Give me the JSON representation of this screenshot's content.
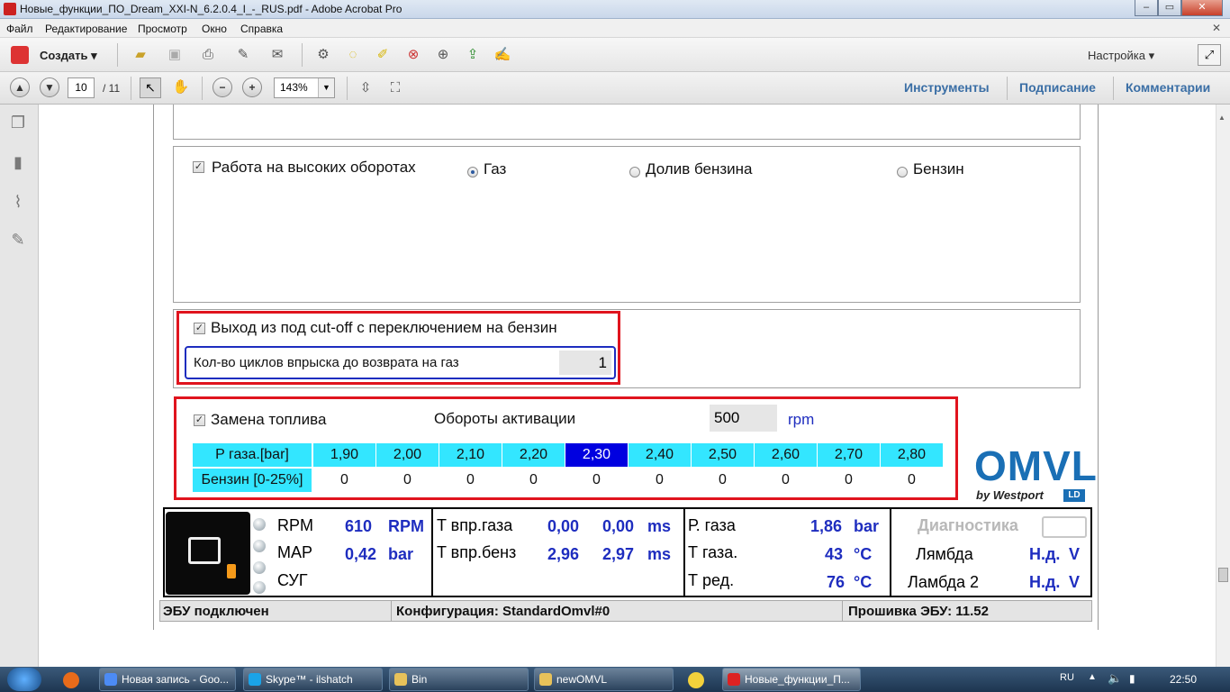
{
  "window": {
    "title": "Новые_функции_ПО_Dream_XXI-N_6.2.0.4_I_-_RUS.pdf - Adobe Acrobat Pro"
  },
  "menu": [
    "Файл",
    "Редактирование",
    "Просмотр",
    "Окно",
    "Справка"
  ],
  "toolbar": {
    "create_label": "Создать",
    "settings_label": "Настройка"
  },
  "nav": {
    "page_current": "10",
    "page_total": "/ 11",
    "zoom": "143%",
    "tab_tools": "Инструменты",
    "tab_sign": "Подписание",
    "tab_comments": "Комментарии"
  },
  "doc": {
    "high_rpm": {
      "label": "Работа на высоких оборотах",
      "radio_gas": "Газ",
      "radio_topup": "Долив бензина",
      "radio_petrol": "Бензин"
    },
    "cutoff": {
      "label": "Выход из под cut-off с переключением на бензин",
      "cycles_label": "Кол-во циклов впрыска до возврата на газ",
      "cycles_value": "1"
    },
    "fuel_swap": {
      "label": "Замена топлива",
      "activation_label": "Обороты активации",
      "activation_value": "500",
      "activation_unit": "rpm",
      "row1_header": "P газа.[bar]",
      "row1_values": [
        "1,90",
        "2,00",
        "2,10",
        "2,20",
        "2,30",
        "2,40",
        "2,50",
        "2,60",
        "2,70",
        "2,80"
      ],
      "row2_header": "Бензин [0-25%]",
      "row2_values": [
        "0",
        "0",
        "0",
        "0",
        "0",
        "0",
        "0",
        "0",
        "0",
        "0"
      ],
      "selected_index": 4
    },
    "logo": {
      "text": "OMVL",
      "sub": "by Westport",
      "badge": "LD"
    },
    "status": {
      "rpm_label": "RPM",
      "rpm_value": "610",
      "rpm_unit": "RPM",
      "map_label": "MAP",
      "map_value": "0,42",
      "map_unit": "bar",
      "sug_label": "СУГ",
      "t_gas_inj_label": "T впр.газа",
      "t_gas_inj_1": "0,00",
      "t_gas_inj_2": "0,00",
      "t_gas_inj_unit": "ms",
      "t_pet_inj_label": "T впр.бенз",
      "t_pet_inj_1": "2,96",
      "t_pet_inj_2": "2,97",
      "t_pet_inj_unit": "ms",
      "p_gas_label": "Р. газа",
      "p_gas_value": "1,86",
      "p_gas_unit": "bar",
      "t_gas_label": "Т газа.",
      "t_gas_value": "43",
      "t_gas_unit": "°C",
      "t_red_label": "Т ред.",
      "t_red_value": "76",
      "t_red_unit": "°C",
      "diag_label": "Диагностика",
      "lambda_label": "Лямбда",
      "lambda_value": "Н.д.",
      "lambda_unit": "V",
      "lambda2_label": "Ламбда 2",
      "lambda2_value": "Н.д.",
      "lambda2_unit": "V"
    },
    "statusbar": {
      "ecu": "ЭБУ подключен",
      "config": "Конфигурация: StandardOmvl#0",
      "firmware": "Прошивка ЭБУ: 11.52"
    }
  },
  "taskbar": {
    "items": [
      "Новая запись - Goo...",
      "Skype™ - ilshatch",
      "Bin",
      "newOMVL",
      "Новые_функции_П..."
    ],
    "lang": "RU",
    "time": "22:50"
  },
  "colors": {
    "accent_blue": "#1e2dbf",
    "highlight_red": "#e0141e",
    "table_cyan": "#33e6ff",
    "selected_cell": "#0000e0",
    "omvl_blue": "#1a6fb5"
  }
}
